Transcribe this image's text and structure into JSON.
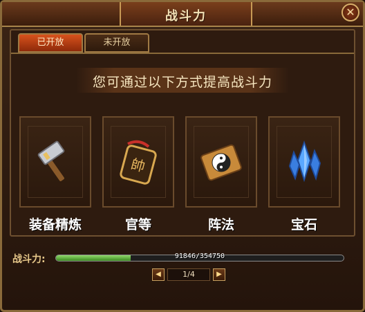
{
  "window": {
    "title": "战斗力",
    "close_label": "✕"
  },
  "tabs": [
    {
      "label": "已开放",
      "active": true
    },
    {
      "label": "未开放",
      "active": false
    }
  ],
  "banner": {
    "text": "您可通过以下方式提高战斗力"
  },
  "options": [
    {
      "label": "装备精炼",
      "icon": "hammer-icon"
    },
    {
      "label": "官等",
      "icon": "marshal-token-icon"
    },
    {
      "label": "阵法",
      "icon": "yin-yang-icon"
    },
    {
      "label": "宝石",
      "icon": "gem-crystal-icon"
    }
  ],
  "power": {
    "label": "战斗力:",
    "current": 91846,
    "max": 354750,
    "text": "91846/354750"
  },
  "pager": {
    "prev_label": "◀",
    "next_label": "▶",
    "page_text": "1/4"
  },
  "colors": {
    "accent": "#d8521c",
    "progress": "#4fa82e",
    "title_text": "#f3e1b5"
  }
}
